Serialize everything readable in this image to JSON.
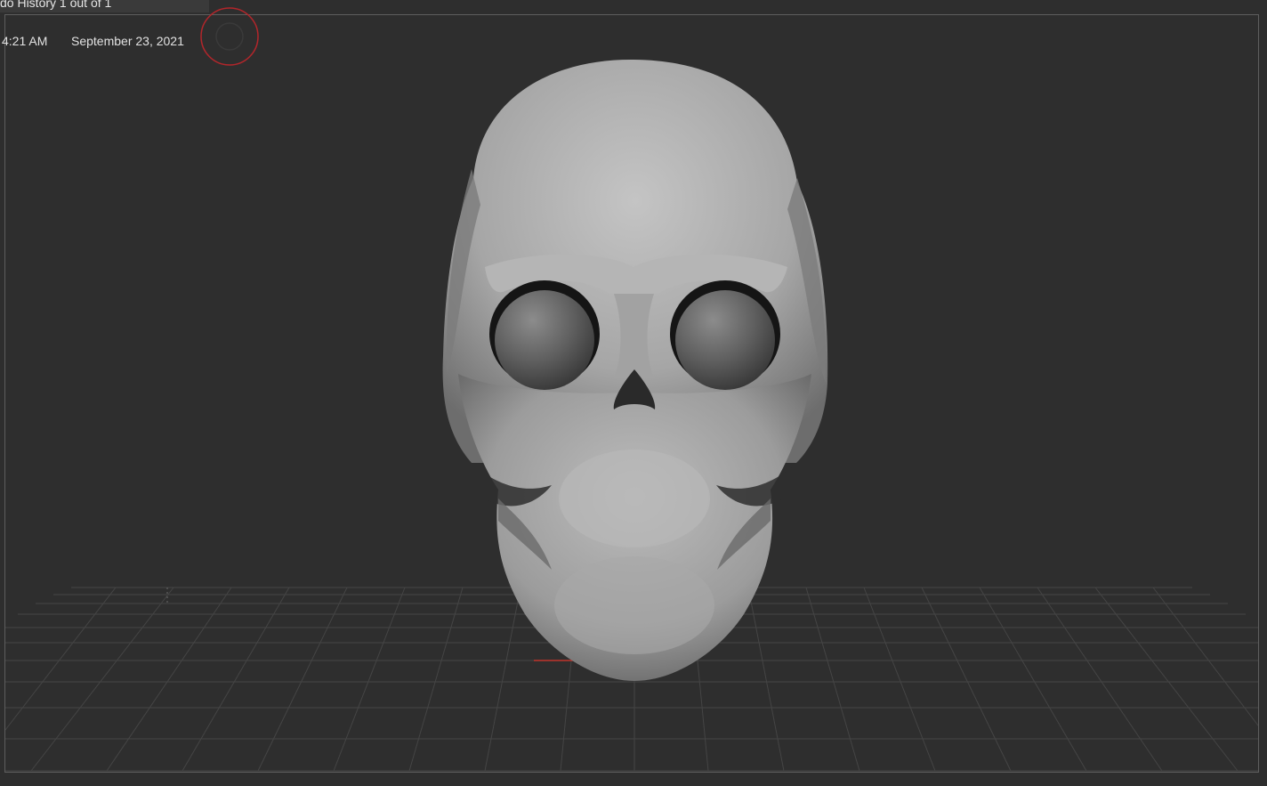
{
  "overlay": {
    "history_label": "do History 1 out of 1",
    "time": "4:21 AM",
    "date": "September 23, 2021"
  },
  "colors": {
    "background": "#2e2e2e",
    "grid_line": "#4a4a4a",
    "axis_red": "#c0342c",
    "indicator_red": "#b3262b",
    "frame_border": "#5e5e5e"
  },
  "icons": {
    "record_indicator": "ring-target-icon"
  }
}
